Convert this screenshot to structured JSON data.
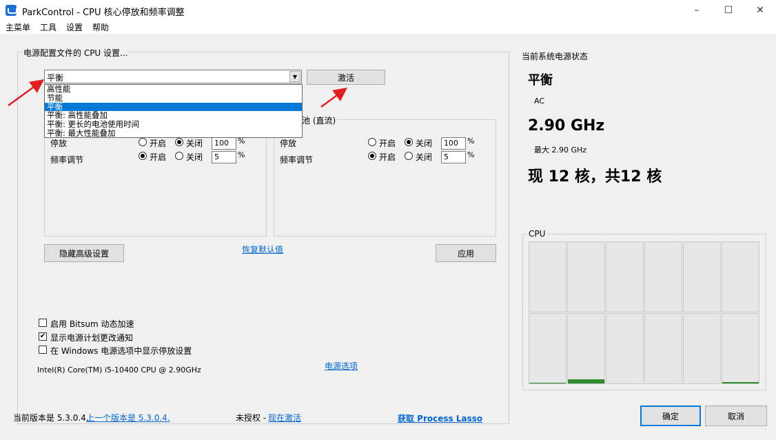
{
  "window": {
    "title": "ParkControl - CPU 核心停放和频率调整",
    "min": "–",
    "max": "☐",
    "close": "✕"
  },
  "menu": [
    "主菜单",
    "工具",
    "设置",
    "帮助"
  ],
  "profile_group": {
    "title": "电源配置文件的 CPU 设置...",
    "combo_value": "平衡",
    "activate_label": "激活",
    "dropdown_options": [
      "高性能",
      "节能",
      "平衡",
      "平衡: 高性能叠加",
      "平衡: 更长的电池使用时间",
      "平衡: 最大性能叠加"
    ],
    "dropdown_selected_index": 2
  },
  "ac_panel": {
    "park_label": "停放",
    "freq_label": "频率调节",
    "park_on": "开启",
    "park_off": "关闭",
    "park_value": "100",
    "freq_on": "开启",
    "freq_off": "关闭",
    "freq_value": "5",
    "pct": "%"
  },
  "dc_panel": {
    "title": "池 (直流)",
    "park_label": "停放",
    "freq_label": "频率调节",
    "park_on": "开启",
    "park_off": "关闭",
    "park_value": "100",
    "freq_on": "开启",
    "freq_off": "关闭",
    "freq_value": "5",
    "pct": "%"
  },
  "buttons": {
    "hide_advanced": "隐藏高级设置",
    "restore_defaults": "恢复默认值",
    "apply": "应用",
    "ok": "确定",
    "cancel": "取消"
  },
  "options": {
    "bitsum": "启用 Bitsum 动态加速",
    "show_notify": "显示电源计划更改通知",
    "show_in_windows": "在 Windows 电源选项中显示停放设置",
    "bitsum_checked": false,
    "notify_checked": true,
    "windows_checked": false,
    "power_options_link": "电源选项"
  },
  "cpu_info": "Intel(R) Core(TM) i5-10400 CPU @ 2.90GHz",
  "status": {
    "title": "当前系统电源状态",
    "plan": "平衡",
    "source": "AC",
    "frequency": "2.90 GHz",
    "max_frequency": "最大 2.90 GHz",
    "cores": "现 12 核，共12 核"
  },
  "cpu_graph": {
    "title": "CPU",
    "core_loads": [
      0,
      0,
      0,
      0,
      0,
      0,
      0.01,
      0.06,
      0,
      0,
      0,
      0.02
    ]
  },
  "footer": {
    "version_label": "当前版本是 5.3.0.4.",
    "prev_version_link": "上一个版本是 5.3.0.4.",
    "unlicensed": "未授权 -",
    "activate_now_link": "现在激活",
    "get_lasso_link": "获取 Process Lasso"
  }
}
